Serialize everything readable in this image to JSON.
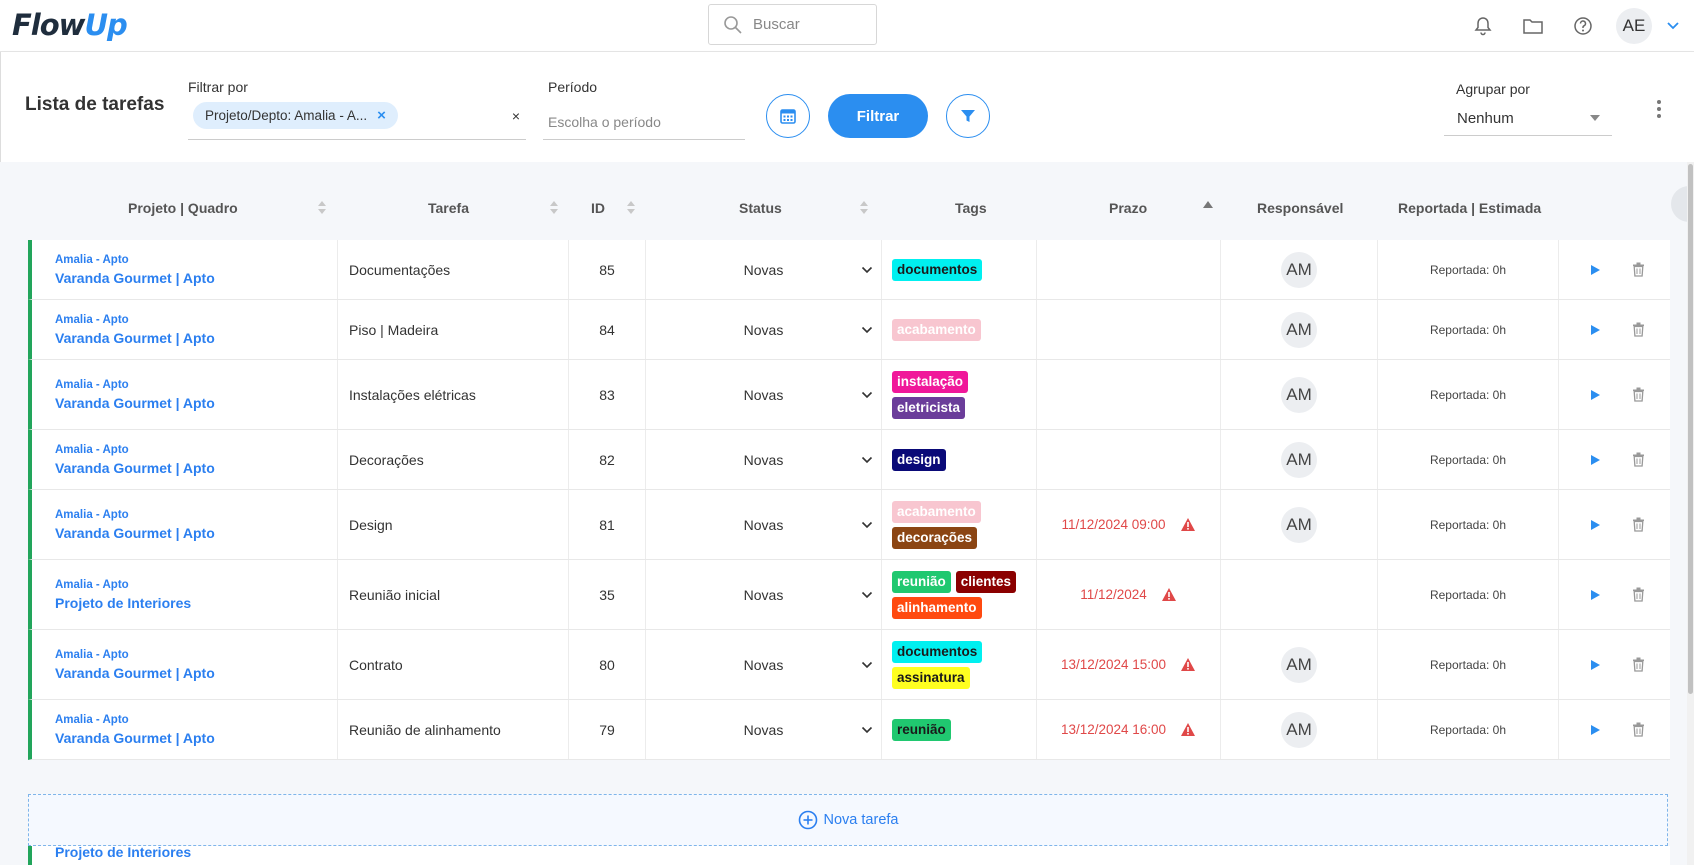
{
  "app": {
    "logo_part1": "Flow",
    "logo_part2": "Up"
  },
  "search": {
    "placeholder": "Buscar"
  },
  "user": {
    "initials": "AE"
  },
  "filterbar": {
    "title": "Lista de tarefas",
    "filter_label": "Filtrar por",
    "filter_chip": "Projeto/Depto: Amalia - A...",
    "clear": "×",
    "period_label": "Período",
    "period_placeholder": "Escolha o período",
    "filter_button": "Filtrar",
    "group_label": "Agrupar por",
    "group_value": "Nenhum"
  },
  "columns": {
    "project": "Projeto | Quadro",
    "task": "Tarefa",
    "id": "ID",
    "status": "Status",
    "tags": "Tags",
    "deadline": "Prazo",
    "owner": "Responsável",
    "reported": "Reportada | Estimada"
  },
  "colors": {
    "accent": "#2b8ef0",
    "row_border": "#22a55b",
    "warning": "#e04848"
  },
  "rows": [
    {
      "project": "Amalia - Apto",
      "board": "Varanda Gourmet | Apto",
      "task": "Documentações",
      "id": "85",
      "status": "Novas",
      "tags": [
        {
          "label": "documentos",
          "bg": "#00f0f0",
          "fg": "#1a1a1a"
        }
      ],
      "deadline": "",
      "warn": false,
      "owner": "AM",
      "reported": "Reportada: 0h",
      "height": 60
    },
    {
      "project": "Amalia - Apto",
      "board": "Varanda Gourmet | Apto",
      "task": "Piso | Madeira",
      "id": "84",
      "status": "Novas",
      "tags": [
        {
          "label": "acabamento",
          "bg": "#f8c6d0",
          "fg": "#ffffff"
        }
      ],
      "deadline": "",
      "warn": false,
      "owner": "AM",
      "reported": "Reportada: 0h",
      "height": 60
    },
    {
      "project": "Amalia - Apto",
      "board": "Varanda Gourmet | Apto",
      "task": "Instalações elétricas",
      "id": "83",
      "status": "Novas",
      "tags": [
        {
          "label": "instalação",
          "bg": "#f0189a",
          "fg": "#ffffff"
        },
        {
          "label": "eletricista",
          "bg": "#6b3d9a",
          "fg": "#ffffff"
        }
      ],
      "deadline": "",
      "warn": false,
      "owner": "AM",
      "reported": "Reportada: 0h",
      "height": 70
    },
    {
      "project": "Amalia - Apto",
      "board": "Varanda Gourmet | Apto",
      "task": "Decorações",
      "id": "82",
      "status": "Novas",
      "tags": [
        {
          "label": "design",
          "bg": "#0a0a78",
          "fg": "#ffffff"
        }
      ],
      "deadline": "",
      "warn": false,
      "owner": "AM",
      "reported": "Reportada: 0h",
      "height": 60
    },
    {
      "project": "Amalia - Apto",
      "board": "Varanda Gourmet | Apto",
      "task": "Design",
      "id": "81",
      "status": "Novas",
      "tags": [
        {
          "label": "acabamento",
          "bg": "#f8c6d0",
          "fg": "#ffffff"
        },
        {
          "label": "decorações",
          "bg": "#8b4513",
          "fg": "#ffffff"
        }
      ],
      "deadline": "11/12/2024  09:00",
      "warn": true,
      "owner": "AM",
      "reported": "Reportada: 0h",
      "height": 70
    },
    {
      "project": "Amalia - Apto",
      "board": "Projeto de Interiores",
      "task": "Reunião inicial",
      "id": "35",
      "status": "Novas",
      "tags": [
        {
          "label": "reunião",
          "bg": "#20c870",
          "fg": "#ffffff"
        },
        {
          "label": "clientes",
          "bg": "#8b0000",
          "fg": "#ffffff"
        },
        {
          "label": "alinhamento",
          "bg": "#ff4a10",
          "fg": "#ffffff"
        }
      ],
      "deadline": "11/12/2024",
      "warn": true,
      "owner": "",
      "reported": "Reportada: 0h",
      "height": 70
    },
    {
      "project": "Amalia - Apto",
      "board": "Varanda Gourmet | Apto",
      "task": "Contrato",
      "id": "80",
      "status": "Novas",
      "tags": [
        {
          "label": "documentos",
          "bg": "#00f0f0",
          "fg": "#1a1a1a"
        },
        {
          "label": "assinatura",
          "bg": "#ffff20",
          "fg": "#1a1a1a"
        }
      ],
      "deadline": "13/12/2024 15:00",
      "warn": true,
      "owner": "AM",
      "reported": "Reportada: 0h",
      "height": 70
    },
    {
      "project": "Amalia - Apto",
      "board": "Varanda Gourmet | Apto",
      "task": "Reunião de alinhamento",
      "id": "79",
      "status": "Novas",
      "tags": [
        {
          "label": "reunião",
          "bg": "#20c870",
          "fg": "#1a1a1a"
        }
      ],
      "deadline": "13/12/2024 16:00",
      "warn": true,
      "owner": "AM",
      "reported": "Reportada: 0h",
      "height": 60
    }
  ],
  "new_task": "Nova tarefa",
  "peek_row": "Projeto de Interiores"
}
